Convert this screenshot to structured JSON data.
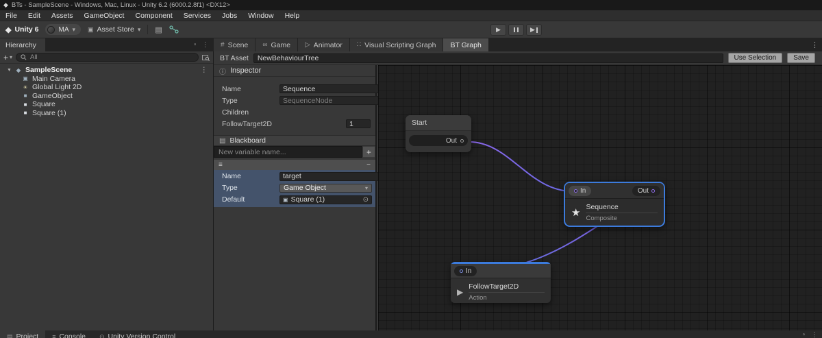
{
  "title_bar": {
    "title": "BTs - SampleScene - Windows, Mac, Linux - Unity 6.2 (6000.2.8f1) <DX12>"
  },
  "menu": {
    "items": [
      "File",
      "Edit",
      "Assets",
      "GameObject",
      "Component",
      "Services",
      "Jobs",
      "Window",
      "Help"
    ]
  },
  "toolbar": {
    "unity_badge": "Unity 6",
    "account_label": "MA",
    "asset_store_label": "Asset Store"
  },
  "hierarchy": {
    "tab_label": "Hierarchy",
    "search_filter": "All",
    "scene_label": "SampleScene",
    "items": [
      {
        "label": "Main Camera",
        "icon": "camera-icon"
      },
      {
        "label": "Global Light 2D",
        "icon": "light-icon"
      },
      {
        "label": "GameObject",
        "icon": "gameobject-icon"
      },
      {
        "label": "Square",
        "icon": "square-icon"
      },
      {
        "label": "Square (1)",
        "icon": "square-icon"
      }
    ]
  },
  "view_tabs": {
    "active": "BT Graph",
    "items": [
      {
        "label": "Scene"
      },
      {
        "label": "Game"
      },
      {
        "label": "Animator"
      },
      {
        "label": "Visual Scripting Graph"
      },
      {
        "label": "BT Graph"
      }
    ]
  },
  "bt_toolbar": {
    "asset_label": "BT Asset",
    "asset_value": "NewBehaviourTree",
    "use_selection_label": "Use Selection",
    "save_label": "Save"
  },
  "inspector": {
    "title": "Inspector",
    "fields": {
      "name_label": "Name",
      "name_value": "Sequence",
      "type_label": "Type",
      "type_value": "SequenceNode",
      "children_label": "Children",
      "child_name": "FollowTarget2D",
      "child_count": "1"
    },
    "blackboard": {
      "title": "Blackboard",
      "new_variable_placeholder": "New variable name...",
      "add_label": "+",
      "variable": {
        "name_label": "Name",
        "name_value": "target",
        "type_label": "Type",
        "type_value": "Game Object",
        "default_label": "Default",
        "default_value": "Square (1)"
      }
    }
  },
  "graph": {
    "start_node": {
      "title": "Start",
      "out_port": "Out"
    },
    "sequence_node": {
      "in_port": "In",
      "out_port": "Out",
      "title": "Sequence",
      "subtitle": "Composite"
    },
    "action_node": {
      "in_port": "In",
      "title": "FollowTarget2D",
      "subtitle": "Action"
    }
  },
  "bottom_bar": {
    "tabs": [
      {
        "label": "Project"
      },
      {
        "label": "Console"
      },
      {
        "label": "Unity Version Control"
      }
    ]
  },
  "icons": {
    "unity_logo": "◆",
    "caret_down": "▾",
    "expand_arrow": "▼",
    "plus": "+",
    "menu_dots": "⋮",
    "lock": "▫",
    "tray": "▤",
    "asset_store": "▣",
    "scene_tab": "#",
    "game_tab": "∞",
    "animator_tab": "▷",
    "vs_graph_tab": "∷",
    "info": "ⓘ",
    "blackboard": "▤",
    "drag_handle": "≡",
    "collapse": "−",
    "object": "▣",
    "object_picker": "⊙",
    "star": "★",
    "play": "▶",
    "camera": "▣",
    "light": "☀",
    "cube": "■",
    "square": "■",
    "scene_obj": "◆"
  },
  "colors": {
    "selection_accent": "#3c7bdc",
    "edge_purple": "#7a63e0",
    "edge_blue": "#5a78e4",
    "variable_selection": "#44536b",
    "panel_bg": "#383838",
    "graph_bg": "#212121"
  }
}
